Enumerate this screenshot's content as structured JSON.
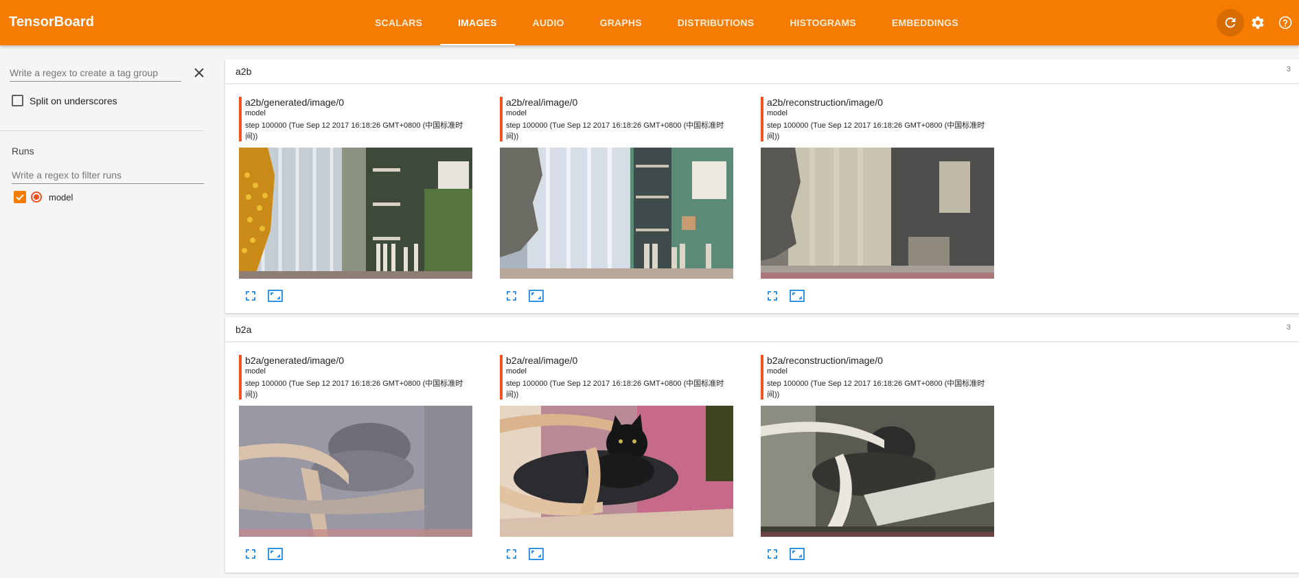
{
  "app": {
    "title": "TensorBoard",
    "accent_color": "#f57c00",
    "run_color": "#f4511e"
  },
  "tabs": [
    {
      "label": "SCALARS",
      "active": false
    },
    {
      "label": "IMAGES",
      "active": true
    },
    {
      "label": "AUDIO",
      "active": false
    },
    {
      "label": "GRAPHS",
      "active": false
    },
    {
      "label": "DISTRIBUTIONS",
      "active": false
    },
    {
      "label": "HISTOGRAMS",
      "active": false
    },
    {
      "label": "EMBEDDINGS",
      "active": false
    }
  ],
  "top_icons": [
    "refresh-icon",
    "settings-icon",
    "help-icon"
  ],
  "sidebar": {
    "tag_regex_placeholder": "Write a regex to create a tag group",
    "tag_regex_value": "",
    "split_label": "Split on underscores",
    "split_checked": false,
    "runs_title": "Runs",
    "runs_filter_placeholder": "Write a regex to filter runs",
    "runs": [
      {
        "name": "model",
        "checked": true,
        "selected": true
      }
    ]
  },
  "groups": [
    {
      "name": "a2b",
      "count": "3",
      "cards": [
        {
          "title": "a2b/generated/image/0",
          "run": "model",
          "step": "step 100000 (Tue Sep 12 2017 16:18:26 GMT+0800 (中国标准时间))",
          "image": "window-curtain-bookshelf-stylized"
        },
        {
          "title": "a2b/real/image/0",
          "run": "model",
          "step": "step 100000 (Tue Sep 12 2017 16:18:26 GMT+0800 (中国标准时间))",
          "image": "window-curtain-bookshelf-anime"
        },
        {
          "title": "a2b/reconstruction/image/0",
          "run": "model",
          "step": "step 100000 (Tue Sep 12 2017 16:18:26 GMT+0800 (中国标准时间))",
          "image": "window-curtain-bookshelf-reconstructed"
        }
      ]
    },
    {
      "name": "b2a",
      "count": "3",
      "cards": [
        {
          "title": "b2a/generated/image/0",
          "run": "model",
          "step": "step 100000 (Tue Sep 12 2017 16:18:26 GMT+0800 (中国标准时间))",
          "image": "cat-on-chair-stylized"
        },
        {
          "title": "b2a/real/image/0",
          "run": "model",
          "step": "step 100000 (Tue Sep 12 2017 16:18:26 GMT+0800 (中国标准时间))",
          "image": "cat-on-chair-photo"
        },
        {
          "title": "b2a/reconstruction/image/0",
          "run": "model",
          "step": "step 100000 (Tue Sep 12 2017 16:18:26 GMT+0800 (中国标准时间))",
          "image": "cat-on-chair-reconstructed"
        }
      ]
    }
  ],
  "card_actions": [
    "fullscreen-icon",
    "actual-size-icon"
  ]
}
